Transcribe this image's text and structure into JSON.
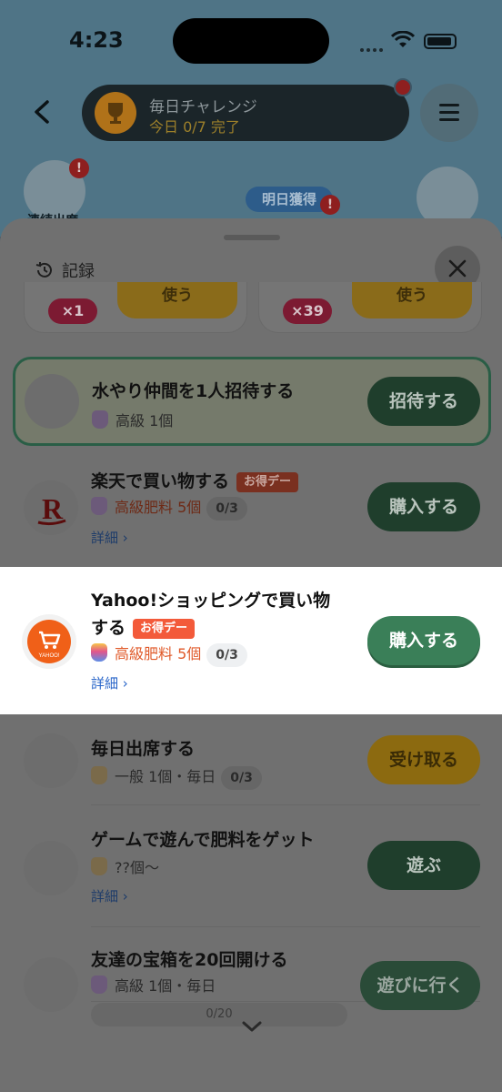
{
  "status_bar": {
    "time": "4:23"
  },
  "header": {
    "challenge_title": "毎日チャレンジ",
    "challenge_progress": "今日 0/7 完了"
  },
  "background": {
    "left_icon_label": "連続出席",
    "tomorrow_label": "明日獲得"
  },
  "sheet": {
    "records_label": "記録",
    "partial_cards": [
      {
        "count": "×1",
        "button": "使う"
      },
      {
        "count": "×39",
        "button": "使う"
      }
    ],
    "tasks": [
      {
        "title": "水やり仲間を1人招待する",
        "reward": "高級 1個",
        "button": "招待する"
      },
      {
        "title": "楽天で買い物する",
        "badge": "お得デー",
        "reward": "高級肥料 5個",
        "progress": "0/3",
        "link": "詳細 ›",
        "button": "購入する"
      },
      {
        "title_line1": "Yahoo!ショッピングで買い物",
        "title_line2": "する",
        "badge": "お得デー",
        "reward": "高級肥料 5個",
        "progress": "0/3",
        "link": "詳細 ›",
        "button": "購入する",
        "logo_text": "YAHOO!"
      },
      {
        "title": "毎日出席する",
        "reward": "一般 1個・毎日",
        "progress": "0/3",
        "button": "受け取る"
      },
      {
        "title": "ゲームで遊んで肥料をゲット",
        "reward": "??個〜",
        "link": "詳細 ›",
        "button": "遊ぶ"
      },
      {
        "title": "友達の宝箱を20回開ける",
        "reward": "高級 1個・毎日",
        "progress": "0/20",
        "button": "遊びに行く"
      }
    ]
  },
  "colors": {
    "accent_green": "#3a7f58",
    "accent_gold": "#f0b020",
    "sale_red": "#f35a3a",
    "reward_orange": "#e05a2a",
    "link_blue": "#2a66c9"
  }
}
